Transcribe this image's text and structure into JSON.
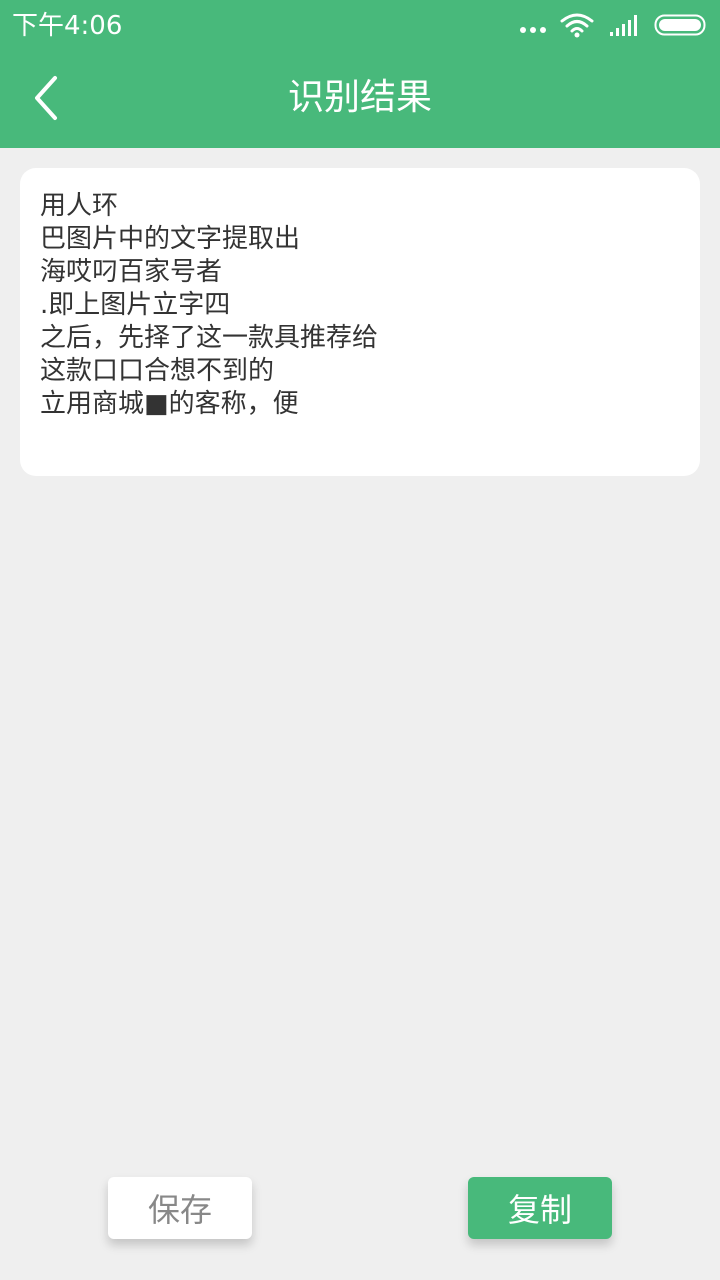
{
  "status_bar": {
    "time": "下午4:06"
  },
  "header": {
    "title": "识别结果",
    "back_icon": "chevron-left-icon"
  },
  "result": {
    "lines": [
      "用人环",
      "巴图片中的文字提取出",
      "海哎叼百家号者",
      ".即上图片立字四",
      "之后，先择了这一款具推荐给",
      "这款口口合想不到的",
      "立用商城■的客称，便"
    ]
  },
  "actions": {
    "save_label": "保存",
    "copy_label": "复制"
  },
  "colors": {
    "accent": "#48b97b",
    "background": "#efefef",
    "card": "#ffffff",
    "text": "#333333",
    "save_text": "#888888"
  }
}
